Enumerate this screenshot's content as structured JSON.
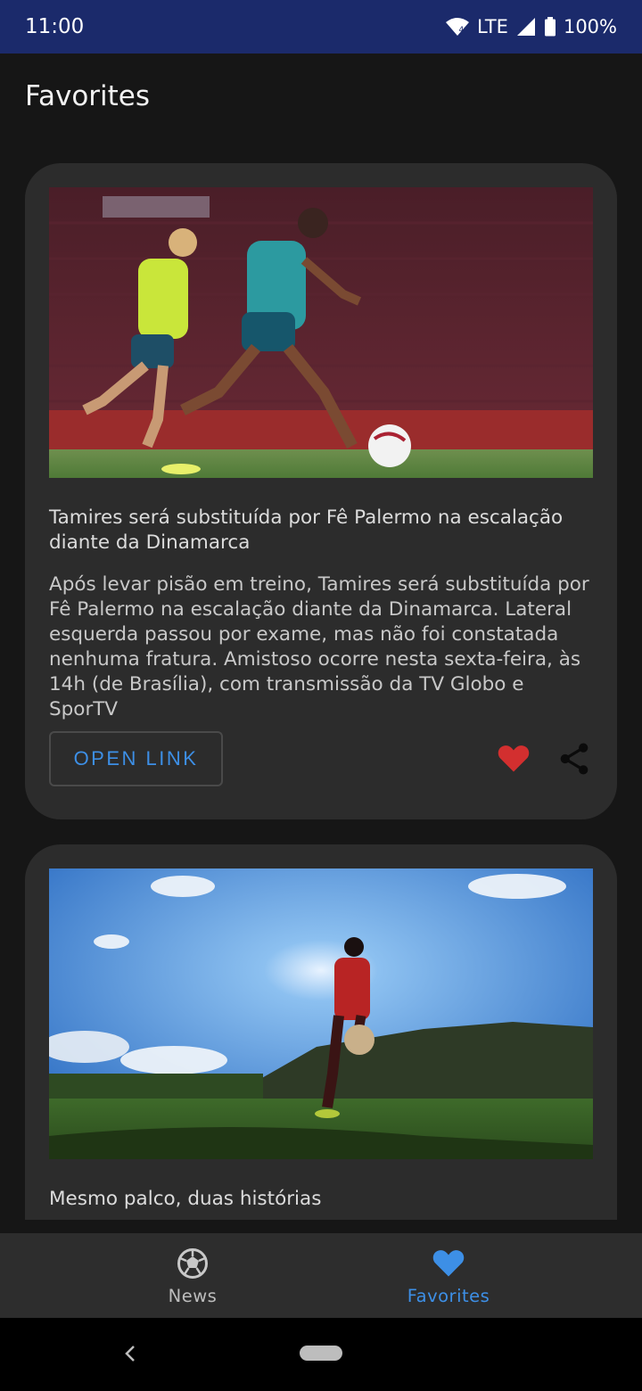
{
  "status_bar": {
    "time": "11:00",
    "network": "LTE",
    "battery": "100%",
    "icons": [
      "wifi-icon",
      "signal-icon",
      "battery-icon"
    ]
  },
  "header": {
    "title": "Favorites"
  },
  "articles": [
    {
      "title": "Tamires será substituída por Fê Palermo na escalação diante da Dinamarca",
      "description": "Após levar pisão em treino, Tamires será substituída por Fê Palermo na escalação diante da Dinamarca. Lateral esquerda passou por exame, mas não foi constatada nenhuma fratura. Amistoso ocorre nesta sexta-feira, às 14h (de Brasília), com transmissão da TV Globo e SporTV",
      "open_link_label": "OPEN LINK",
      "favorited": true
    },
    {
      "title": "Mesmo palco, duas histórias"
    }
  ],
  "bottom_nav": [
    {
      "label": "News",
      "icon": "soccer-ball-icon",
      "active": false
    },
    {
      "label": "Favorites",
      "icon": "heart-icon",
      "active": true
    }
  ],
  "colors": {
    "accent": "#3d8fe6",
    "favorite": "#d32f2f",
    "status_bar": "#1b2a6b",
    "card": "#2c2c2c",
    "background": "#161616"
  }
}
